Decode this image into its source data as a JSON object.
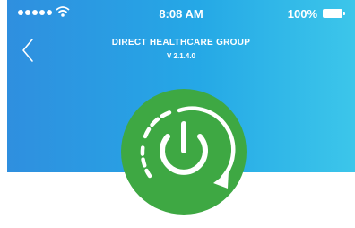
{
  "status_bar": {
    "time": "8:08 AM",
    "battery": "100%",
    "signal_icon": "signal-dots-icon",
    "wifi_icon": "wifi-icon",
    "battery_icon": "battery-icon"
  },
  "header": {
    "title": "DIRECT HEALTHCARE GROUP",
    "version": "V 2.1.4.0",
    "back_icon": "chevron-left-icon"
  },
  "power_button": {
    "icon": "power-icon",
    "accent": "#3ea843",
    "ring_color": "#ffffff"
  },
  "colors": {
    "header_start": "#2f8fdf",
    "header_end": "#3cc6ea"
  }
}
